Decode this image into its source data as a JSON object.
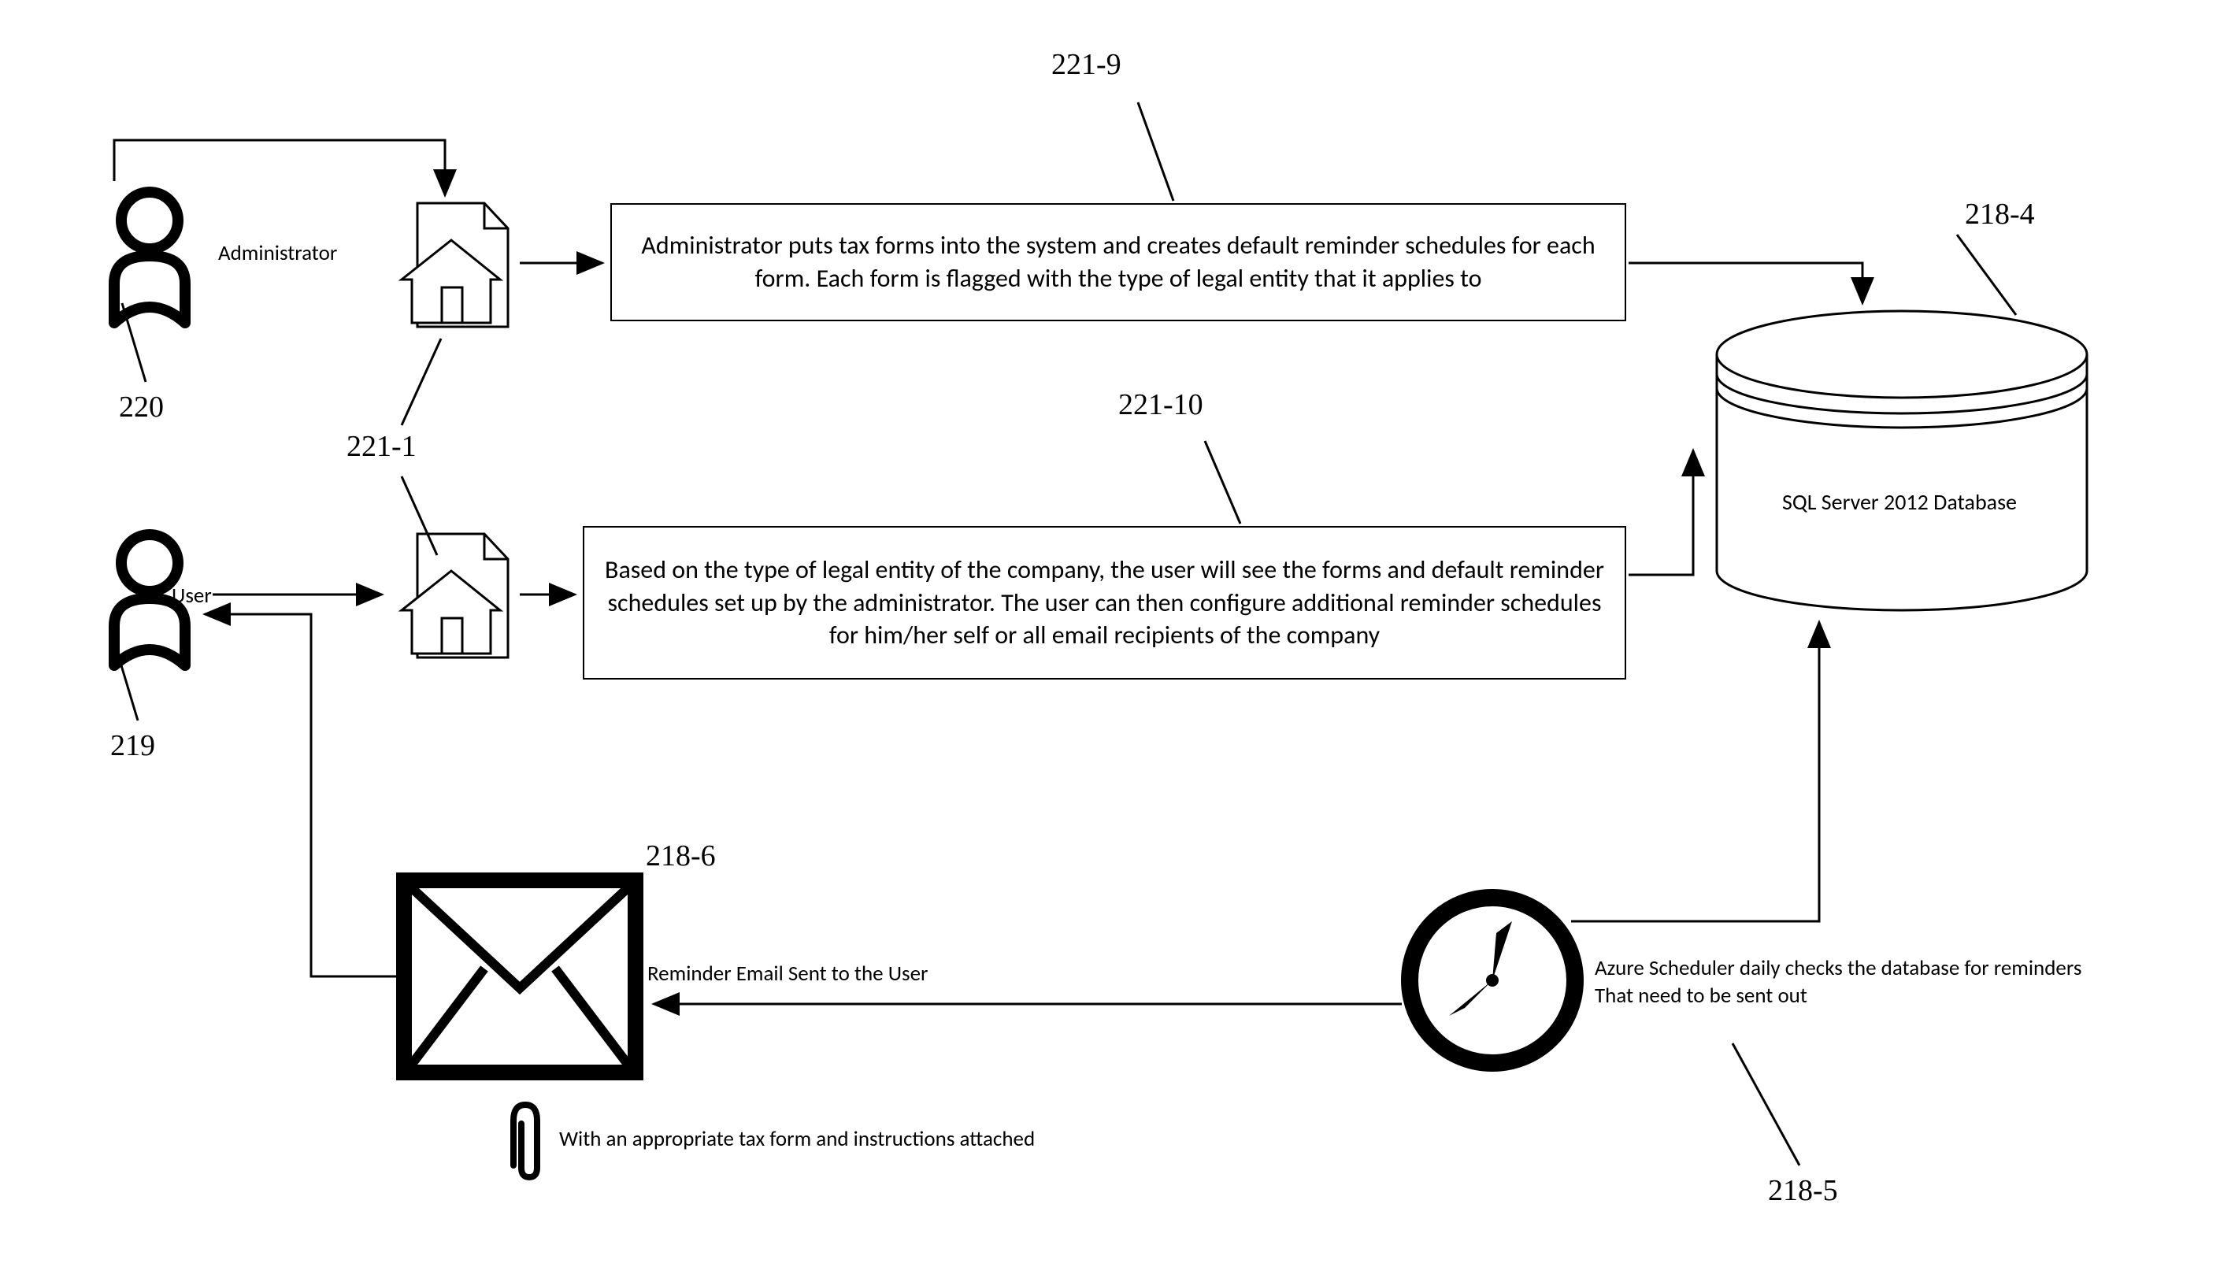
{
  "refs": {
    "admin_actor": "220",
    "user_actor": "219",
    "home_admin": "221-1",
    "box_admin": "221-9",
    "box_user": "221-10",
    "database": "218-4",
    "scheduler": "218-5",
    "email": "218-6"
  },
  "actors": {
    "admin_label": "Administrator",
    "user_label": "User"
  },
  "boxes": {
    "admin_text": "Administrator puts tax forms into the system and creates default reminder schedules for each form. Each form is flagged with the type of legal entity that it applies to",
    "user_text": "Based on the type of legal entity of the company, the user will see the forms and default reminder schedules set up by the administrator. The user can then configure additional reminder schedules for him/her self or all email recipients of the company"
  },
  "database_label": "SQL Server 2012 Database",
  "email_caption": "Reminder Email Sent to the User",
  "attachment_caption": "With an appropriate tax form and instructions attached",
  "scheduler_caption_line1": "Azure Scheduler daily checks the database for reminders",
  "scheduler_caption_line2": "That need to be sent out"
}
